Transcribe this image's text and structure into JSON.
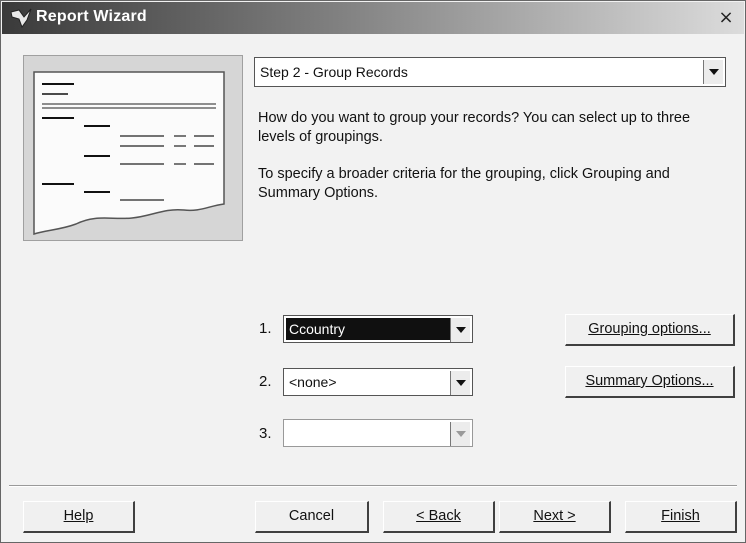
{
  "window": {
    "title": "Report Wizard",
    "icon": "wizard-icon",
    "close_label": "×"
  },
  "step_select": {
    "value": "Step 2 - Group Records"
  },
  "description": {
    "line1": "How do you want to group your records? You can select up to three levels of groupings.",
    "line2": "To specify a broader criteria for the grouping, click Grouping and Summary Options."
  },
  "groups": [
    {
      "number": "1.",
      "value": "Ccountry",
      "state": "selected"
    },
    {
      "number": "2.",
      "value": "<none>",
      "state": "normal"
    },
    {
      "number": "3.",
      "value": "",
      "state": "disabled"
    }
  ],
  "buttons": {
    "grouping_options": "Grouping options...",
    "summary_options": "Summary Options...",
    "help": "Help",
    "cancel": "Cancel",
    "back": "< Back",
    "next": "Next >",
    "finish": "Finish"
  },
  "colors": {
    "title_gradient_start": "#3a3a3a",
    "selection": "#101010"
  }
}
